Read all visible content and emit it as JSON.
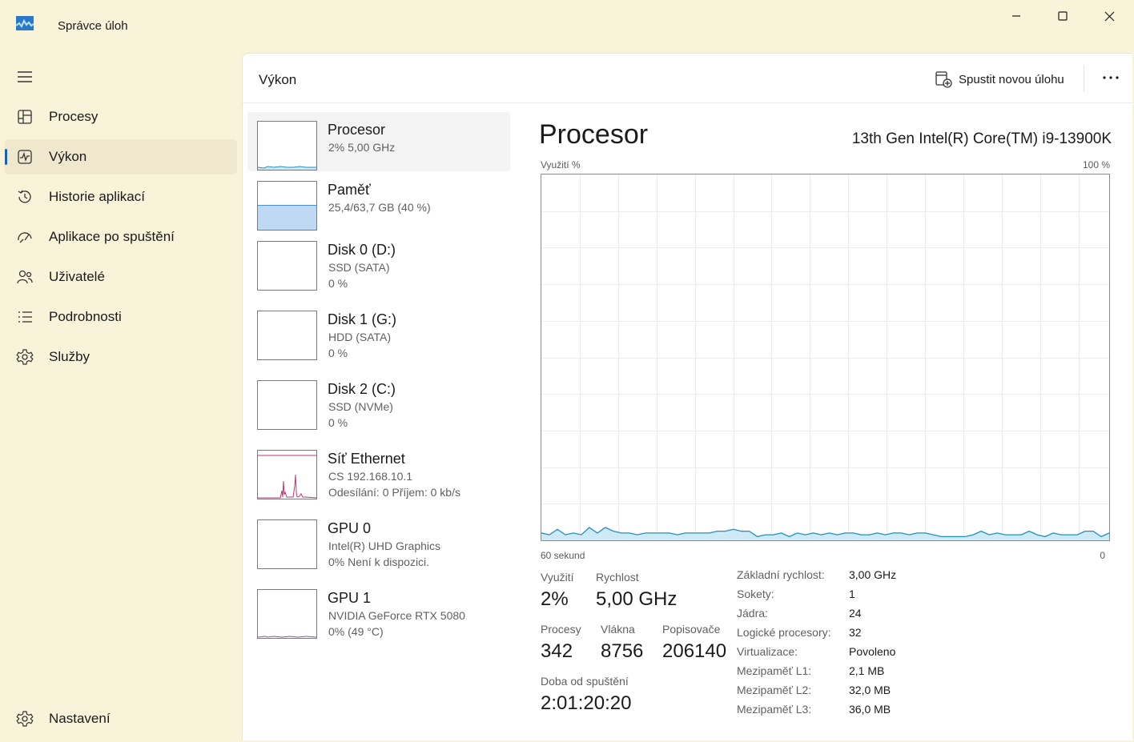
{
  "window": {
    "title": "Správce úloh"
  },
  "sidebar": {
    "items": [
      {
        "label": "Procesy"
      },
      {
        "label": "Výkon"
      },
      {
        "label": "Historie aplikací"
      },
      {
        "label": "Aplikace po spuštění"
      },
      {
        "label": "Uživatelé"
      },
      {
        "label": "Podrobnosti"
      },
      {
        "label": "Služby"
      }
    ],
    "active_index": 1,
    "settings_label": "Nastavení"
  },
  "header": {
    "title": "Výkon",
    "new_task_label": "Spustit novou úlohu"
  },
  "devices": [
    {
      "name": "Procesor",
      "sub1": "2%  5,00 GHz",
      "sub2": "",
      "selected": true
    },
    {
      "name": "Paměť",
      "sub1": "25,4/63,7 GB (40 %)",
      "sub2": ""
    },
    {
      "name": "Disk 0 (D:)",
      "sub1": "SSD (SATA)",
      "sub2": "0 %"
    },
    {
      "name": "Disk 1 (G:)",
      "sub1": "HDD (SATA)",
      "sub2": "0 %"
    },
    {
      "name": "Disk 2 (C:)",
      "sub1": "SSD (NVMe)",
      "sub2": "0 %"
    },
    {
      "name": "Síť Ethernet",
      "sub1": "CS 192.168.10.1",
      "sub2": "Odesílání: 0 Příjem: 0 kb/s"
    },
    {
      "name": "GPU 0",
      "sub1": "Intel(R) UHD Graphics",
      "sub2": "0%  Není k dispozici."
    },
    {
      "name": "GPU 1",
      "sub1": "NVIDIA GeForce RTX 5080",
      "sub2": "0%  (49 °C)"
    }
  ],
  "detail": {
    "title": "Procesor",
    "model": "13th Gen Intel(R) Core(TM) i9-13900K",
    "axis_top_left": "Využití %",
    "axis_top_right": "100 %",
    "axis_bottom_left": "60 sekund",
    "axis_bottom_right": "0",
    "stats": {
      "usage_label": "Využití",
      "usage_value": "2%",
      "speed_label": "Rychlost",
      "speed_value": "5,00 GHz",
      "processes_label": "Procesy",
      "processes_value": "342",
      "threads_label": "Vlákna",
      "threads_value": "8756",
      "handles_label": "Popisovače",
      "handles_value": "206140",
      "uptime_label": "Doba od spuštění",
      "uptime_value": "2:01:20:20"
    },
    "specs": [
      {
        "label": "Základní rychlost:",
        "value": "3,00 GHz"
      },
      {
        "label": "Sokety:",
        "value": "1"
      },
      {
        "label": "Jádra:",
        "value": "24"
      },
      {
        "label": "Logické procesory:",
        "value": "32"
      },
      {
        "label": "Virtualizace:",
        "value": "Povoleno"
      },
      {
        "label": "Mezipaměť L1:",
        "value": "2,1 MB"
      },
      {
        "label": "Mezipaměť L2:",
        "value": "32,0 MB"
      },
      {
        "label": "Mezipaměť L3:",
        "value": "36,0 MB"
      }
    ]
  },
  "colors": {
    "cpu_line": "#1f8fc9",
    "cpu_fill": "#cfe9f5",
    "memory_fill": "#bfd9f5",
    "net_line": "#b43a75",
    "accent": "#1a5fb4"
  },
  "chart_data": {
    "type": "area",
    "title": "",
    "xlabel": "",
    "ylabel": "Využití %",
    "xlim": [
      60,
      0
    ],
    "ylim": [
      0,
      100
    ],
    "grid": true,
    "series": [
      {
        "values": [
          2,
          1.5,
          3,
          1.5,
          2,
          1.5,
          3.5,
          2,
          3.5,
          2.5,
          2,
          2,
          1.5,
          2,
          2,
          2,
          2,
          1.5,
          2,
          2,
          2,
          2,
          2.5,
          2.5,
          3,
          2.5,
          2.5,
          1,
          1.5,
          1.5,
          2,
          1,
          2,
          1.5,
          2,
          1.5,
          2,
          1.5,
          2,
          2,
          1.5,
          1.5,
          2,
          1.5,
          2,
          2,
          1.5,
          2,
          2,
          1.5,
          1,
          1,
          1,
          1,
          1.5,
          2.5,
          1.5,
          2,
          1.5,
          1.5,
          1.5,
          2.5,
          1.5,
          1,
          2,
          1.5,
          1.5,
          1.5,
          2.5,
          2.5,
          1,
          2
        ]
      }
    ]
  }
}
